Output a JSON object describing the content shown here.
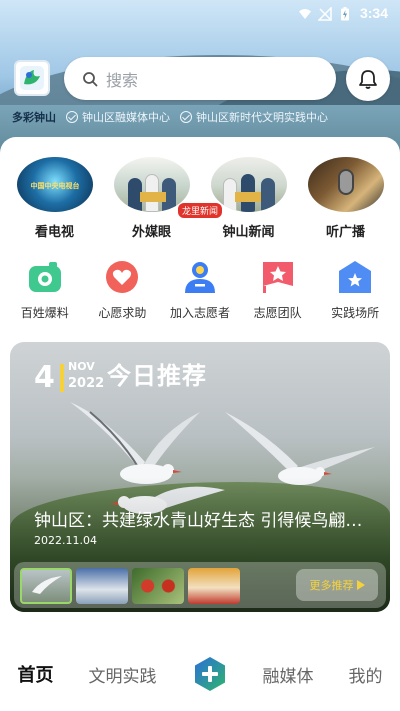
{
  "status_bar": {
    "time": "3:34"
  },
  "header": {
    "search_placeholder": "搜索",
    "tags": {
      "main": "多彩钟山",
      "items": [
        "钟山区融媒体中心",
        "钟山区新时代文明实践中心"
      ]
    }
  },
  "media": [
    {
      "label": "看电视",
      "badge": "龙里新闻",
      "inner_text": "中国中央电视台"
    },
    {
      "label": "外媒眼"
    },
    {
      "label": "钟山新闻"
    },
    {
      "label": "听广播"
    }
  ],
  "services": [
    {
      "label": "百姓爆料",
      "icon": "camera-icon",
      "color": "#3fc98e"
    },
    {
      "label": "心愿求助",
      "icon": "heart-icon",
      "color": "#f0625a"
    },
    {
      "label": "加入志愿者",
      "icon": "user-plus-icon",
      "color": "#3d7df3"
    },
    {
      "label": "志愿团队",
      "icon": "star-flag-icon",
      "color": "#f25b6b"
    },
    {
      "label": "实践场所",
      "icon": "house-star-icon",
      "color": "#4f8df5"
    }
  ],
  "recommend": {
    "day": "4",
    "month": "NOV",
    "year": "2022",
    "title": "今日推荐",
    "headline": "钟山区：共建绿水青山好生态 引得候鸟翩跹来",
    "date": "2022.11.04",
    "more_label": "更多推荐"
  },
  "peek_text": "推荐",
  "bottom_nav": {
    "items": [
      "首页",
      "文明实践",
      "融媒体",
      "我的"
    ],
    "active": "首页"
  },
  "colors": {
    "accent_green": "#2fb46d",
    "accent_blue": "#2c6fd8",
    "badge_red": "#e0332b",
    "highlight_yellow": "#f5d23b"
  }
}
